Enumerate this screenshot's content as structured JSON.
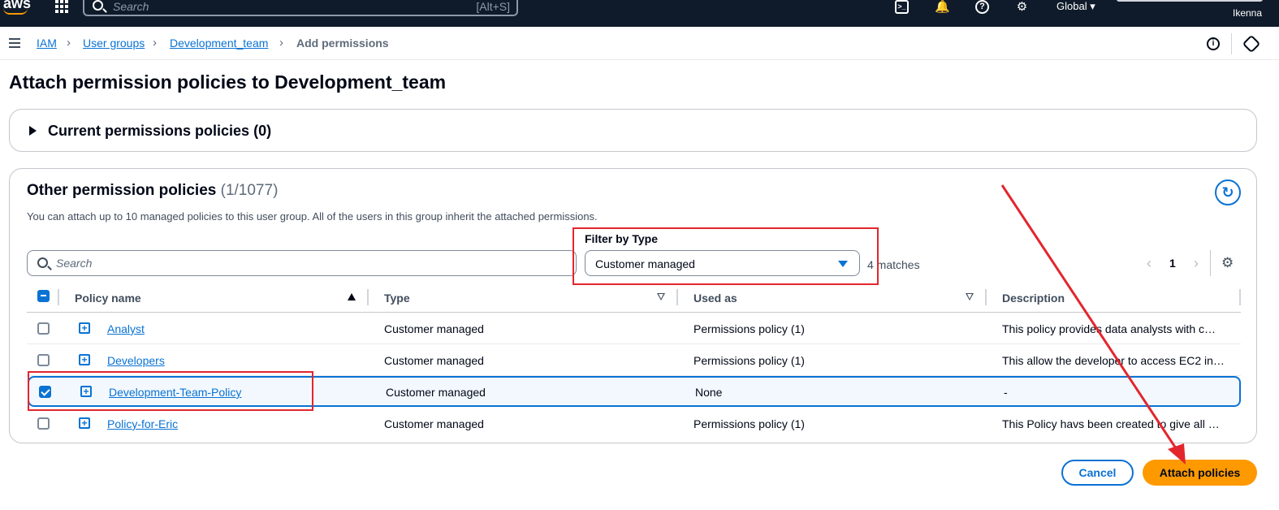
{
  "topbar": {
    "logo": "aws",
    "search_placeholder": "Search",
    "search_shortcut": "[Alt+S]",
    "region": "Global",
    "username": "Ikenna",
    "icons": [
      "grid-icon",
      "cloudshell-icon",
      "bell-icon",
      "help-icon",
      "gear-icon"
    ]
  },
  "breadcrumb": {
    "items": [
      "IAM",
      "User groups",
      "Development_team"
    ],
    "current": "Add permissions"
  },
  "page": {
    "title": "Attach permission policies to Development_team"
  },
  "current_policies": {
    "label": "Current permissions policies (0)"
  },
  "other_policies": {
    "heading": "Other permission policies",
    "count": "(1/1077)",
    "description": "You can attach up to 10 managed policies to this user group. All of the users in this group inherit the attached permissions.",
    "search_placeholder": "Search",
    "filter_label": "Filter by Type",
    "filter_value": "Customer managed",
    "matches": "4 matches",
    "page_number": "1",
    "columns": [
      "Policy name",
      "Type",
      "Used as",
      "Description"
    ],
    "rows": [
      {
        "name": "Analyst",
        "type": "Customer managed",
        "used_as": "Permissions policy (1)",
        "description": "This policy provides data analysts with c…",
        "checked": false
      },
      {
        "name": "Developers",
        "type": "Customer managed",
        "used_as": "Permissions policy (1)",
        "description": "This allow the developer to access EC2 in…",
        "checked": false
      },
      {
        "name": "Development-Team-Policy",
        "type": "Customer managed",
        "used_as": "None",
        "description": "-",
        "checked": true
      },
      {
        "name": "Policy-for-Eric",
        "type": "Customer managed",
        "used_as": "Permissions policy (1)",
        "description": "This Policy havs been created to give all …",
        "checked": false
      }
    ]
  },
  "actions": {
    "cancel": "Cancel",
    "attach": "Attach policies"
  },
  "colors": {
    "accent": "#0972d3",
    "primary_button": "#ff9900",
    "annotation_red": "#e3262d",
    "topbar": "#0f1b2a"
  }
}
